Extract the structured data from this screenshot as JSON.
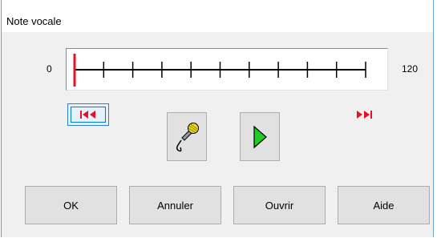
{
  "window": {
    "title": "Note vocale"
  },
  "slider": {
    "min_label": "0",
    "max_label": "120",
    "min": 0,
    "max": 120,
    "value": 0,
    "tick_count": 11,
    "marker_color": "#e81123"
  },
  "transport": {
    "skip_start_icon": "skip-to-start-icon",
    "skip_end_icon": "skip-to-end-icon",
    "record_icon": "microphone-icon",
    "play_icon": "play-icon",
    "skip_color": "#e81123",
    "play_color": "#22cc22"
  },
  "buttons": {
    "ok": "OK",
    "cancel": "Annuler",
    "open": "Ouvrir",
    "help": "Aide"
  }
}
